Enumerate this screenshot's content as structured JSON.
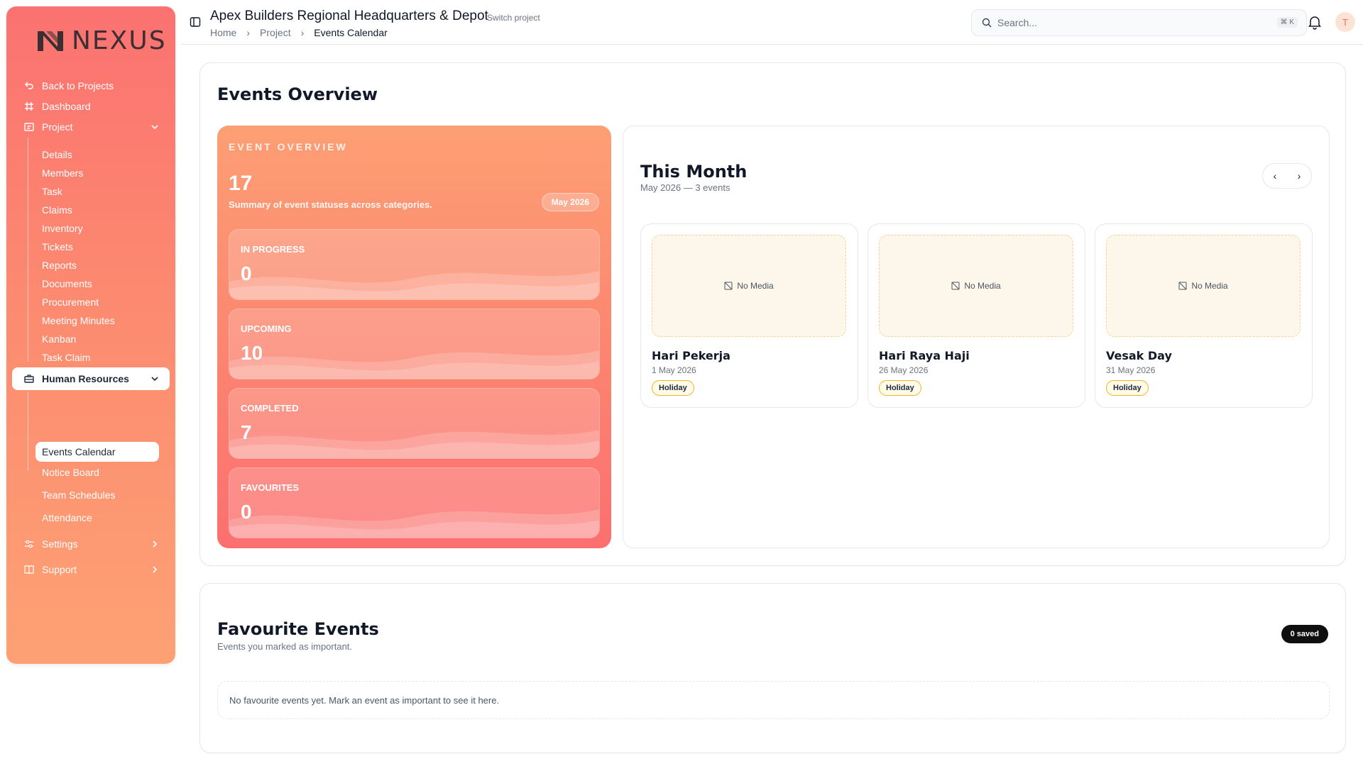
{
  "brand": {
    "name": "NEXUS"
  },
  "sidebar": {
    "back": "Back to Projects",
    "dashboard": "Dashboard",
    "project": "Project",
    "project_items": [
      "Details",
      "Members",
      "Task",
      "Claims",
      "Inventory",
      "Tickets",
      "Reports",
      "Documents",
      "Procurement",
      "Meeting Minutes",
      "Kanban",
      "Task Claim"
    ],
    "hr": "Human Resources",
    "hr_items": [
      "Events Calendar",
      "Notice Board",
      "Team Schedules",
      "Attendance"
    ],
    "settings": "Settings",
    "support": "Support"
  },
  "header": {
    "title": "Apex Builders Regional Headquarters & Depot",
    "switch": "Switch project",
    "breadcrumb": [
      "Home",
      "Project",
      "Events Calendar"
    ],
    "search_placeholder": "Search...",
    "shortcut": "⌘ K",
    "avatar": "T"
  },
  "overview": {
    "heading": "Events Overview",
    "label": "EVENT OVERVIEW",
    "total": "17",
    "summary": "Summary of event statuses across categories.",
    "month_badge": "May 2026",
    "stats": [
      {
        "label": "IN PROGRESS",
        "value": "0"
      },
      {
        "label": "UPCOMING",
        "value": "10"
      },
      {
        "label": "COMPLETED",
        "value": "7"
      },
      {
        "label": "FAVOURITES",
        "value": "0"
      }
    ]
  },
  "this_month": {
    "title": "This Month",
    "subtitle": "May 2026 — 3 events",
    "prev": "‹",
    "next": "›",
    "events": [
      {
        "media": "No Media",
        "name": "Hari Pekerja",
        "date": "1 May 2026",
        "tag": "Holiday"
      },
      {
        "media": "No Media",
        "name": "Hari Raya Haji",
        "date": "26 May 2026",
        "tag": "Holiday"
      },
      {
        "media": "No Media",
        "name": "Vesak Day",
        "date": "31 May 2026",
        "tag": "Holiday"
      }
    ]
  },
  "favourites": {
    "title": "Favourite Events",
    "subtitle": "Events you marked as important.",
    "count": "0 saved",
    "empty": "No favourite events yet. Mark an event as important to see it here."
  },
  "colors": {
    "accent": "#fc7d70",
    "sidebar_top": "#fb7271",
    "sidebar_bottom": "#fda174",
    "holiday_border": "#f5b323"
  }
}
